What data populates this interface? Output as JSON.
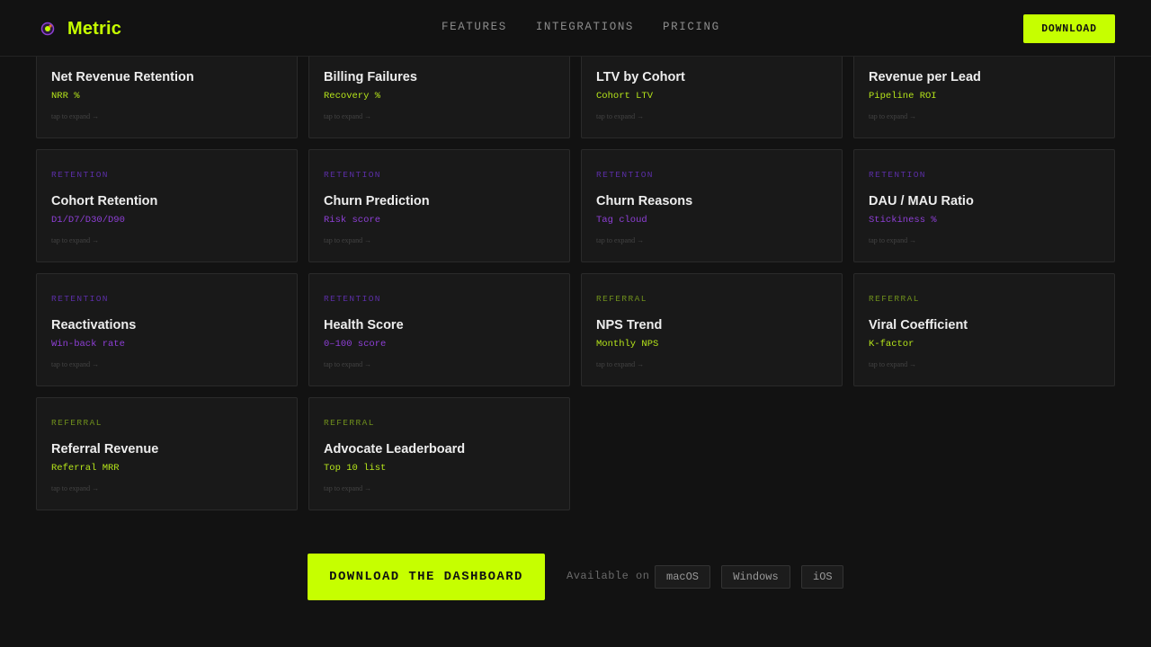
{
  "header": {
    "brand": "Metric",
    "nav": [
      "FEATURES",
      "INTEGRATIONS",
      "PRICING"
    ],
    "download_label": "DOWNLOAD",
    "accent": "#c6ff00"
  },
  "cards": [
    {
      "category": "revenue",
      "tag": "",
      "title": "Net Revenue Retention",
      "subtitle": "NRR %",
      "hint": "tap to expand →"
    },
    {
      "category": "revenue",
      "tag": "",
      "title": "Billing Failures",
      "subtitle": "Recovery %",
      "hint": "tap to expand →"
    },
    {
      "category": "revenue",
      "tag": "",
      "title": "LTV by Cohort",
      "subtitle": "Cohort LTV",
      "hint": "tap to expand →"
    },
    {
      "category": "revenue",
      "tag": "",
      "title": "Revenue per Lead",
      "subtitle": "Pipeline ROI",
      "hint": "tap to expand →"
    },
    {
      "category": "retention",
      "tag": "RETENTION",
      "title": "Cohort Retention",
      "subtitle": "D1/D7/D30/D90",
      "hint": "tap to expand →"
    },
    {
      "category": "retention",
      "tag": "RETENTION",
      "title": "Churn Prediction",
      "subtitle": "Risk score",
      "hint": "tap to expand →"
    },
    {
      "category": "retention",
      "tag": "RETENTION",
      "title": "Churn Reasons",
      "subtitle": "Tag cloud",
      "hint": "tap to expand →"
    },
    {
      "category": "retention",
      "tag": "RETENTION",
      "title": "DAU / MAU Ratio",
      "subtitle": "Stickiness %",
      "hint": "tap to expand →"
    },
    {
      "category": "retention",
      "tag": "RETENTION",
      "title": "Reactivations",
      "subtitle": "Win-back rate",
      "hint": "tap to expand →"
    },
    {
      "category": "retention",
      "tag": "RETENTION",
      "title": "Health Score",
      "subtitle": "0–100 score",
      "hint": "tap to expand →"
    },
    {
      "category": "referral",
      "tag": "REFERRAL",
      "title": "NPS Trend",
      "subtitle": "Monthly NPS",
      "hint": "tap to expand →"
    },
    {
      "category": "referral",
      "tag": "REFERRAL",
      "title": "Viral Coefficient",
      "subtitle": "K-factor",
      "hint": "tap to expand →"
    },
    {
      "category": "referral",
      "tag": "REFERRAL",
      "title": "Referral Revenue",
      "subtitle": "Referral MRR",
      "hint": "tap to expand →"
    },
    {
      "category": "referral",
      "tag": "REFERRAL",
      "title": "Advocate Leaderboard",
      "subtitle": "Top 10 list",
      "hint": "tap to expand →"
    }
  ],
  "footer": {
    "cta_label": "DOWNLOAD THE DASHBOARD",
    "available_label": "Available on",
    "platforms": [
      "macOS",
      "Windows",
      "iOS"
    ]
  }
}
